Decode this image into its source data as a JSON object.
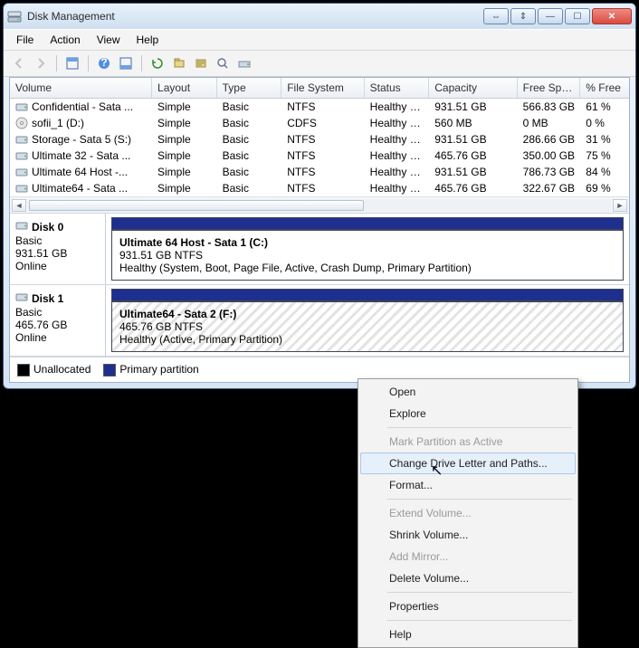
{
  "title": "Disk Management",
  "menus": [
    "File",
    "Action",
    "View",
    "Help"
  ],
  "columns": [
    "Volume",
    "Layout",
    "Type",
    "File System",
    "Status",
    "Capacity",
    "Free Spa...",
    "% Free"
  ],
  "volumes": [
    {
      "name": "Confidential - Sata ...",
      "icon": "drive",
      "layout": "Simple",
      "type": "Basic",
      "fs": "NTFS",
      "status": "Healthy (A...",
      "cap": "931.51 GB",
      "free": "566.83 GB",
      "pct": "61 %"
    },
    {
      "name": "sofii_1 (D:)",
      "icon": "cd",
      "layout": "Simple",
      "type": "Basic",
      "fs": "CDFS",
      "status": "Healthy (P...",
      "cap": "560 MB",
      "free": "0 MB",
      "pct": "0 %"
    },
    {
      "name": "Storage - Sata 5 (S:)",
      "icon": "drive",
      "layout": "Simple",
      "type": "Basic",
      "fs": "NTFS",
      "status": "Healthy (P...",
      "cap": "931.51 GB",
      "free": "286.66 GB",
      "pct": "31 %"
    },
    {
      "name": "Ultimate 32 - Sata ...",
      "icon": "drive",
      "layout": "Simple",
      "type": "Basic",
      "fs": "NTFS",
      "status": "Healthy (P...",
      "cap": "465.76 GB",
      "free": "350.00 GB",
      "pct": "75 %"
    },
    {
      "name": "Ultimate 64 Host -...",
      "icon": "drive",
      "layout": "Simple",
      "type": "Basic",
      "fs": "NTFS",
      "status": "Healthy (S...",
      "cap": "931.51 GB",
      "free": "786.73 GB",
      "pct": "84 %"
    },
    {
      "name": "Ultimate64 - Sata ...",
      "icon": "drive",
      "layout": "Simple",
      "type": "Basic",
      "fs": "NTFS",
      "status": "Healthy (A...",
      "cap": "465.76 GB",
      "free": "322.67 GB",
      "pct": "69 %"
    }
  ],
  "disks": [
    {
      "name": "Disk 0",
      "type": "Basic",
      "size": "931.51 GB",
      "status": "Online",
      "part": {
        "title": "Ultimate 64 Host - Sata 1  (C:)",
        "sub": "931.51 GB NTFS",
        "health": "Healthy (System, Boot, Page File, Active, Crash Dump, Primary Partition)",
        "hatch": false
      }
    },
    {
      "name": "Disk 1",
      "type": "Basic",
      "size": "465.76 GB",
      "status": "Online",
      "part": {
        "title": "Ultimate64 - Sata 2  (F:)",
        "sub": "465.76 GB NTFS",
        "health": "Healthy (Active, Primary Partition)",
        "hatch": true
      }
    }
  ],
  "legend": {
    "unalloc": "Unallocated",
    "primary": "Primary partition"
  },
  "context_menu": [
    {
      "label": "Open",
      "enabled": true
    },
    {
      "label": "Explore",
      "enabled": true
    },
    {
      "sep": true
    },
    {
      "label": "Mark Partition as Active",
      "enabled": false
    },
    {
      "label": "Change Drive Letter and Paths...",
      "enabled": true,
      "hover": true
    },
    {
      "label": "Format...",
      "enabled": true
    },
    {
      "sep": true
    },
    {
      "label": "Extend Volume...",
      "enabled": false
    },
    {
      "label": "Shrink Volume...",
      "enabled": true
    },
    {
      "label": "Add Mirror...",
      "enabled": false
    },
    {
      "label": "Delete Volume...",
      "enabled": true
    },
    {
      "sep": true
    },
    {
      "label": "Properties",
      "enabled": true
    },
    {
      "sep": true
    },
    {
      "label": "Help",
      "enabled": true
    }
  ]
}
